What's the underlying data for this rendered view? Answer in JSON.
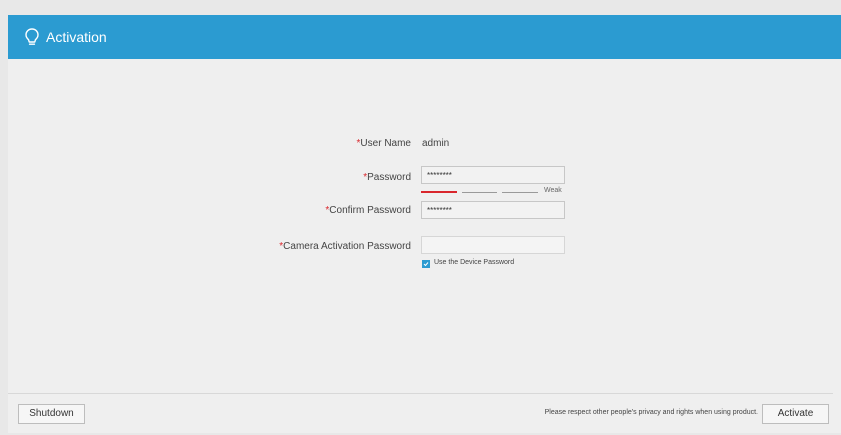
{
  "header": {
    "title": "Activation",
    "icon": "lightbulb-icon"
  },
  "form": {
    "username": {
      "label": "User Name",
      "value": "admin"
    },
    "password": {
      "label": "Password",
      "value": "********",
      "strength": "Weak"
    },
    "confirm_password": {
      "label": "Confirm Password",
      "value": "********"
    },
    "camera_password": {
      "label": "Camera Activation Password",
      "value": ""
    },
    "use_device_password": {
      "label": "Use the Device Password",
      "checked": true
    },
    "required_mark": "*"
  },
  "footer": {
    "shutdown_label": "Shutdown",
    "privacy_note": "Please respect other people's privacy and rights when using product.",
    "activate_label": "Activate"
  },
  "colors": {
    "accent": "#2b9bd1",
    "required": "#d9262c",
    "strength_weak": "#d9262c",
    "strength_inactive": "#9a9a9a"
  }
}
